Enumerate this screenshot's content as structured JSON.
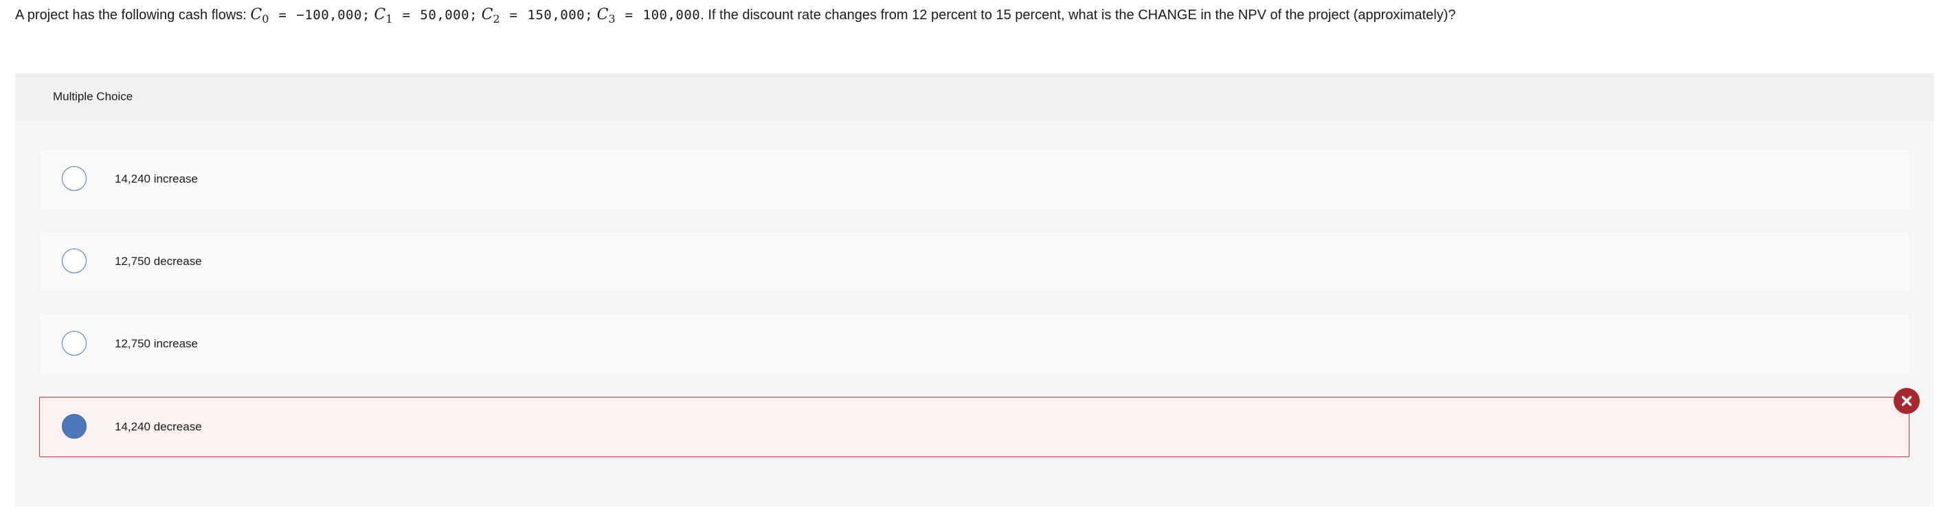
{
  "question": {
    "intro": "A project has the following cash flows: ",
    "cashflows": [
      {
        "var": "C",
        "sub": "0",
        "value": "−100,000",
        "sep": ";"
      },
      {
        "var": "C",
        "sub": "1",
        "value": "50,000",
        "sep": ";"
      },
      {
        "var": "C",
        "sub": "2",
        "value": "150,000",
        "sep": ";"
      },
      {
        "var": "C",
        "sub": "3",
        "value": "100,000",
        "sep": ""
      }
    ],
    "equals": "=",
    "outro": ". If the discount rate changes from 12 percent to 15 percent, what is the CHANGE in the NPV of the project (approximately)?"
  },
  "panel": {
    "header": "Multiple Choice"
  },
  "options": [
    {
      "label": "14,240 increase",
      "selected": false
    },
    {
      "label": "12,750 decrease",
      "selected": false
    },
    {
      "label": "12,750 increase",
      "selected": false
    },
    {
      "label": "14,240 decrease",
      "selected": true,
      "status": "incorrect"
    }
  ],
  "colors": {
    "radio_border": "#4a77b0",
    "radio_selected": "#4a78b8",
    "incorrect_border": "#c2393b",
    "incorrect_badge": "#a6272c"
  },
  "icons": {
    "incorrect": "x-circle-icon"
  }
}
